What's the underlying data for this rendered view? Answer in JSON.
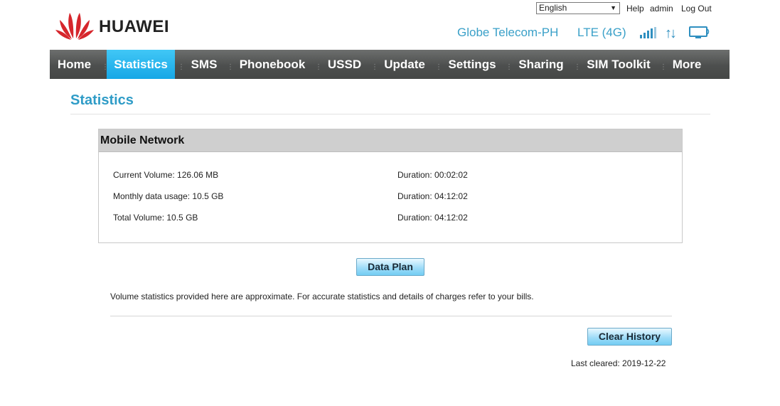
{
  "header": {
    "brand": "HUAWEI",
    "language": "English",
    "help_label": "Help",
    "user_label": "admin",
    "logout_label": "Log Out",
    "operator": "Globe Telecom-PH",
    "network_type": "LTE (4G)",
    "signal_bars": 4,
    "accent_color": "#3aa0c8"
  },
  "nav": {
    "items": [
      "Home",
      "Statistics",
      "SMS",
      "Phonebook",
      "USSD",
      "Update",
      "Settings",
      "Sharing",
      "SIM Toolkit",
      "More"
    ],
    "active": "Statistics",
    "active_color": "#1eb0ee"
  },
  "page": {
    "title": "Statistics"
  },
  "mobile_network": {
    "heading": "Mobile Network",
    "rows": [
      {
        "volume": "Current Volume: 126.06 MB",
        "duration": "Duration: 00:02:02"
      },
      {
        "volume": "Monthly data usage: 10.5 GB",
        "duration": "Duration: 04:12:02"
      },
      {
        "volume": "Total Volume: 10.5 GB",
        "duration": "Duration: 04:12:02"
      }
    ]
  },
  "actions": {
    "data_plan_label": "Data Plan",
    "clear_history_label": "Clear History"
  },
  "note": "Volume statistics provided here are approximate. For accurate statistics and details of charges refer to your bills.",
  "last_cleared": "Last cleared: 2019-12-22"
}
